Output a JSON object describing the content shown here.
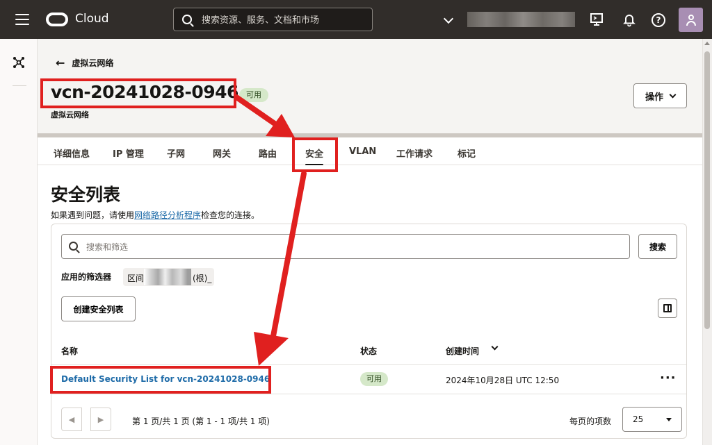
{
  "header": {
    "brand": "Cloud",
    "search_placeholder": "搜索资源、服务、文档和市场"
  },
  "breadcrumb": {
    "back_label": "虚拟云网络"
  },
  "page": {
    "title": "vcn-20241028-0946",
    "status": "可用",
    "subtitle": "虚拟云网络",
    "actions_label": "操作"
  },
  "tabs": [
    {
      "label": "详细信息"
    },
    {
      "label": "IP 管理"
    },
    {
      "label": "子网"
    },
    {
      "label": "网关"
    },
    {
      "label": "路由"
    },
    {
      "label": "安全",
      "active": true
    },
    {
      "label": "VLAN"
    },
    {
      "label": "工作请求"
    },
    {
      "label": "标记"
    }
  ],
  "section": {
    "title": "安全列表",
    "hint_pre": "如果遇到问题，请使用",
    "hint_link": "网络路径分析程序",
    "hint_post": "检查您的连接。"
  },
  "filters": {
    "search_placeholder": "搜索和筛选",
    "search_button": "搜索",
    "applied_label": "应用的筛选器",
    "chip_prefix": "区间",
    "chip_suffix": "(根)_"
  },
  "create_button": "创建安全列表",
  "table": {
    "columns": [
      "名称",
      "状态",
      "创建时间"
    ],
    "rows": [
      {
        "name": "Default Security List for vcn-20241028-0946",
        "status": "可用",
        "created": "2024年10月28日 UTC 12:50",
        "menu": "···"
      }
    ]
  },
  "pagination": {
    "summary": "第 1 页/共 1 页 (第 1 - 1 项/共 1 项)",
    "per_page_label": "每页的项数",
    "per_page_value": "25"
  },
  "colors": {
    "header_bg": "#312d2a",
    "link": "#1e6ba8",
    "badge_bg": "#d5e8c9",
    "annotation_red": "#e0201f"
  },
  "icons": [
    "hamburger-icon",
    "oracle-logo-icon",
    "search-icon",
    "chevron-down-icon",
    "cloud-shell-icon",
    "bell-icon",
    "help-icon",
    "user-icon",
    "network-icon",
    "back-arrow-icon",
    "columns-icon",
    "kebab-icon",
    "caret-down-icon"
  ]
}
